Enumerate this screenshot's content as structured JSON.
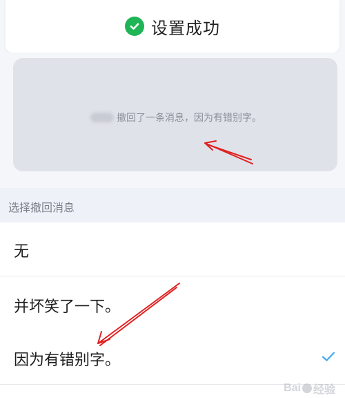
{
  "toast": {
    "icon": "check-circle-icon",
    "icon_color": "#1fb455",
    "text": "设置成功"
  },
  "preview": {
    "message": "撤回了一条消息，因为有错别字。"
  },
  "section": {
    "title": "选择撤回消息"
  },
  "options": [
    {
      "label": "无",
      "selected": false
    },
    {
      "label": "并坏笑了一下。",
      "selected": false
    },
    {
      "label": "因为有错别字。",
      "selected": true
    }
  ],
  "colors": {
    "accent": "#3fa9f5",
    "annotation": "#e02020"
  },
  "watermark": {
    "text_left": "Bai",
    "text_right": "经验"
  }
}
